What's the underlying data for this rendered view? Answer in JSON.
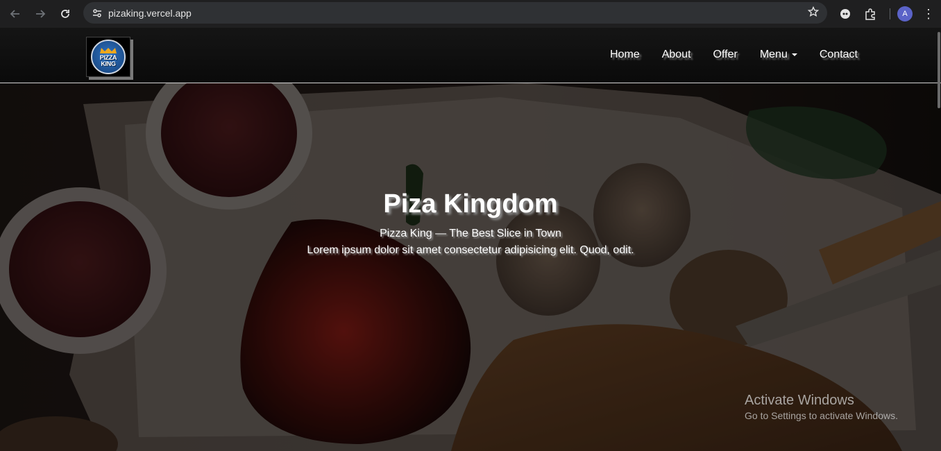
{
  "browser": {
    "url": "pizaking.vercel.app",
    "avatar_initial": "A",
    "icons": [
      "back-icon",
      "forward-icon",
      "reload-icon",
      "site-info-icon",
      "star-icon",
      "extension-icon",
      "puzzle-icon",
      "menu-kebab-icon"
    ]
  },
  "site": {
    "logo": {
      "line1": "PIZZA",
      "line2": "KING"
    },
    "nav": {
      "items": [
        {
          "label": "Home"
        },
        {
          "label": "About"
        },
        {
          "label": "Offer"
        },
        {
          "label": "Menu"
        },
        {
          "label": "Contact"
        }
      ]
    },
    "hero": {
      "title": "Piza Kingdom",
      "subtitle": "Pizza King — The Best Slice in Town",
      "description": "Lorem ipsum dolor sit amet consectetur adipisicing elit. Quod, odit."
    }
  },
  "os": {
    "activate_title": "Activate Windows",
    "activate_sub": "Go to Settings to activate Windows."
  },
  "colors": {
    "chrome_bg": "#1f1f20",
    "omnibox_bg": "#2f3134",
    "navbar_bg": "#0d0d0d",
    "avatar": "#5b63c8",
    "logo_blue": "#2e74c4",
    "crown_gold": "#f0a81c"
  }
}
